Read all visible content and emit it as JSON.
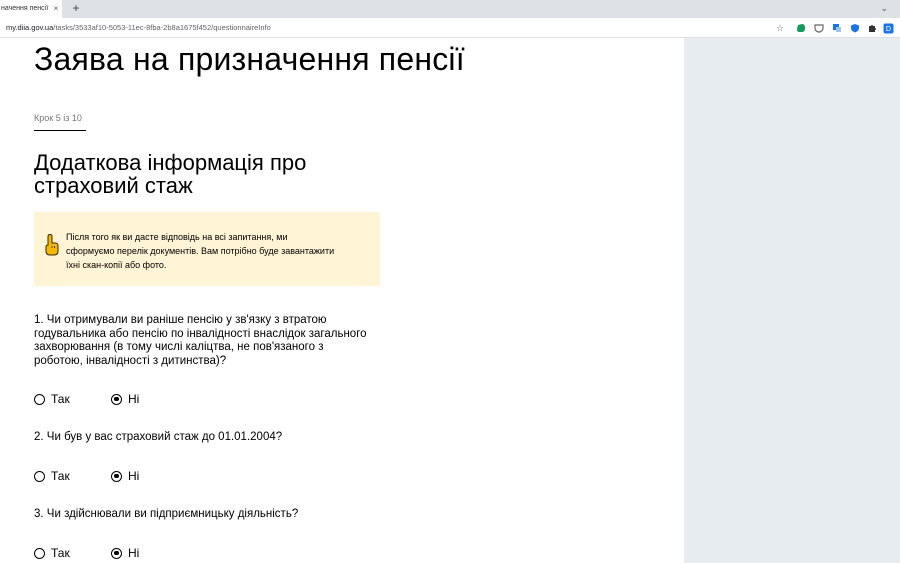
{
  "browser": {
    "tab_title": "начення пенсії | Д",
    "tab_close": "×",
    "new_tab": "+",
    "tab_menu": "⌄",
    "url_host": "my.diia.gov.ua",
    "url_path": "/tasks/3533af10-5053-11ec-8fba-2b8a1675f452/questionnaireInfo"
  },
  "page": {
    "title": "Заява на призначення пенсії",
    "step": "Крок 5 із 10",
    "section_title": "Додаткова інформація про страховий стаж",
    "notice": "Після того як ви дасте відповідь на всі запитання, ми сформуємо перелік документів. Вам потрібно буде завантажити їхні скан-копії або фото."
  },
  "questions": [
    {
      "text": "1. Чи отримували ви раніше пенсію у зв'язку з втратою годувальника або пенсію по інвалідності внаслідок загального захворювання (в тому числі каліцтва, не пов'язаного з роботою, інвалідності з дитинства)?",
      "options": [
        "Так",
        "Ні"
      ],
      "selected": "Ні"
    },
    {
      "text": "2. Чи був у вас страховий стаж до 01.01.2004?",
      "options": [
        "Так",
        "Ні"
      ],
      "selected": "Ні"
    },
    {
      "text": "3. Чи здійснювали ви підприємницьку діяльність?",
      "options": [
        "Так",
        "Ні"
      ],
      "selected": "Ні"
    }
  ],
  "colors": {
    "notice_bg": "#fff4d6",
    "side_panel": "#e7ecf0",
    "hand_icon": "#f5b800"
  }
}
